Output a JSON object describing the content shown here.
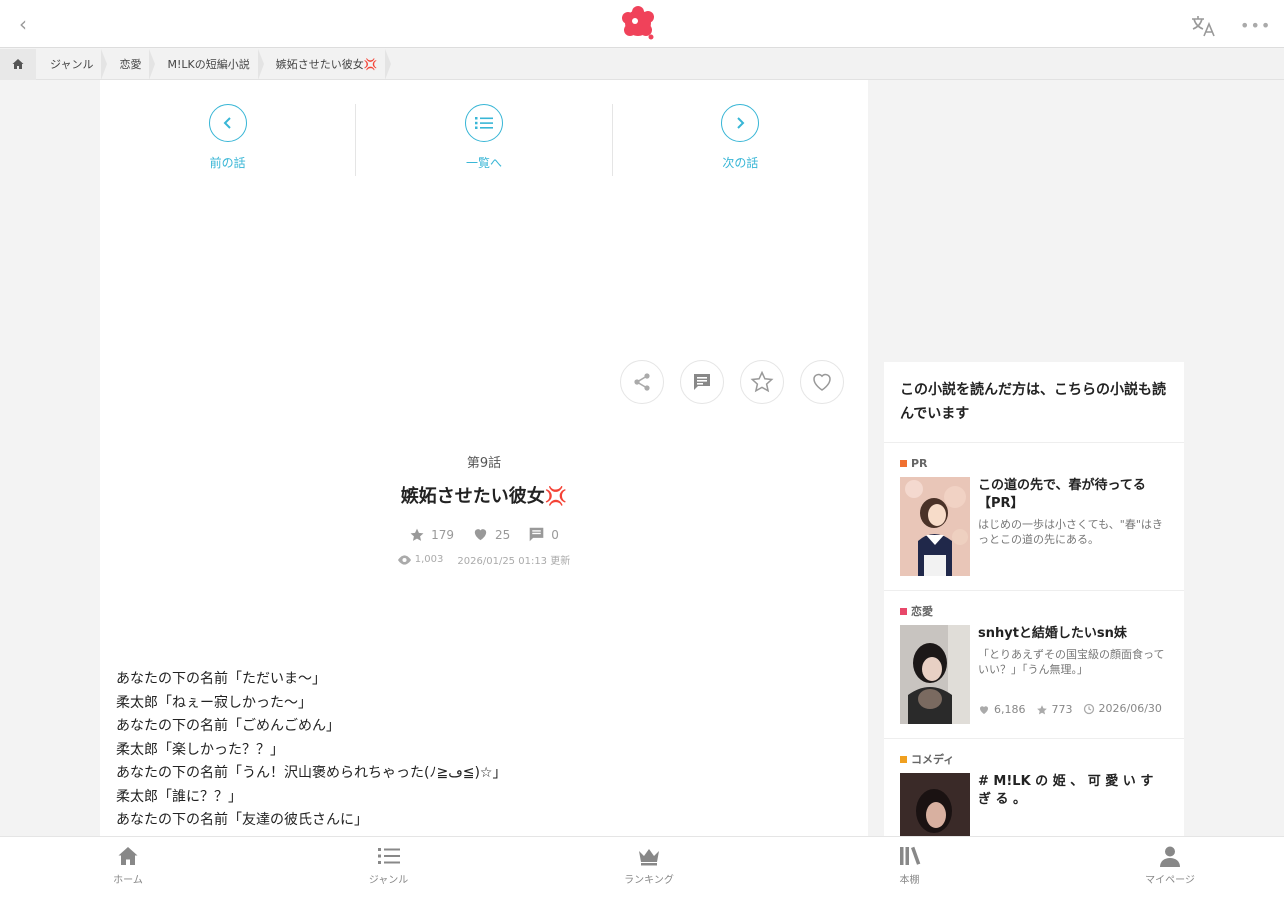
{
  "topbar": {
    "back": "‹",
    "more": "•••"
  },
  "breadcrumb": [
    "ジャンル",
    "恋愛",
    "M!LKの短編小説",
    "嫉妬させたい彼女💢"
  ],
  "episode_nav": {
    "prev": "前の話",
    "list": "一覧へ",
    "next": "次の話"
  },
  "episode": {
    "number": "第9話",
    "title": "嫉妬させたい彼女💢",
    "stars": "179",
    "hearts": "25",
    "comments": "0",
    "views": "1,003",
    "updated": "2026/01/25 01:13 更新"
  },
  "body_lines": [
    "あなたの下の名前「ただいま〜」",
    "柔太郎「ねぇー寂しかった〜」",
    "あなたの下の名前「ごめんごめん」",
    "柔太郎「楽しかった？？」",
    "あなたの下の名前「うん！沢山褒められちゃった(ﾉ≧ڡ≦)☆」",
    "柔太郎「誰に？？」",
    "あなたの下の名前「友達の彼氏さんに」"
  ],
  "sidebar": {
    "heading": "この小説を読んだ方は、こちらの小説も読んでいます",
    "cards": [
      {
        "tag": "PR",
        "tag_color": "#f07030",
        "title": "この道の先で、春が待ってる【PR】",
        "desc": "はじめの一歩は小さくても、\"春\"はきっとこの道の先にある。"
      },
      {
        "tag": "恋愛",
        "tag_color": "#e8486a",
        "title": "snhytと結婚したいsn妹",
        "desc": "「とりあえずその国宝級の顔面食っていい？」「うん無理。」",
        "likes": "6,186",
        "stars": "773",
        "date": "2026/06/30"
      },
      {
        "tag": "コメディ",
        "tag_color": "#f0a020",
        "title": "# M!LK の 姫 、 可 愛 い す ぎ る 。",
        "desc": ""
      }
    ]
  },
  "bottom_nav": {
    "home": "ホーム",
    "genre": "ジャンル",
    "ranking": "ランキング",
    "shelf": "本棚",
    "mypage": "マイページ"
  }
}
